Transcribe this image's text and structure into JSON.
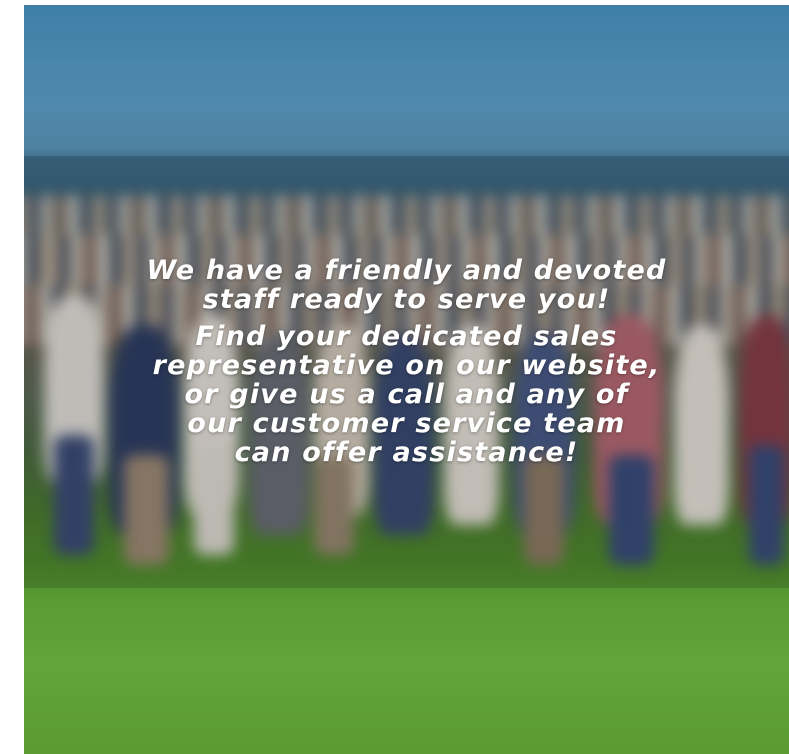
{
  "banner": {
    "image": "staff-group-photo",
    "line1": "We have a friendly and devoted",
    "line2": "staff ready to serve you!",
    "line3": "Find your dedicated sales",
    "line4": "representative on our website,",
    "line5": "or give us a call and any of",
    "line6": "our customer service team",
    "line7": "can offer assistance!"
  }
}
